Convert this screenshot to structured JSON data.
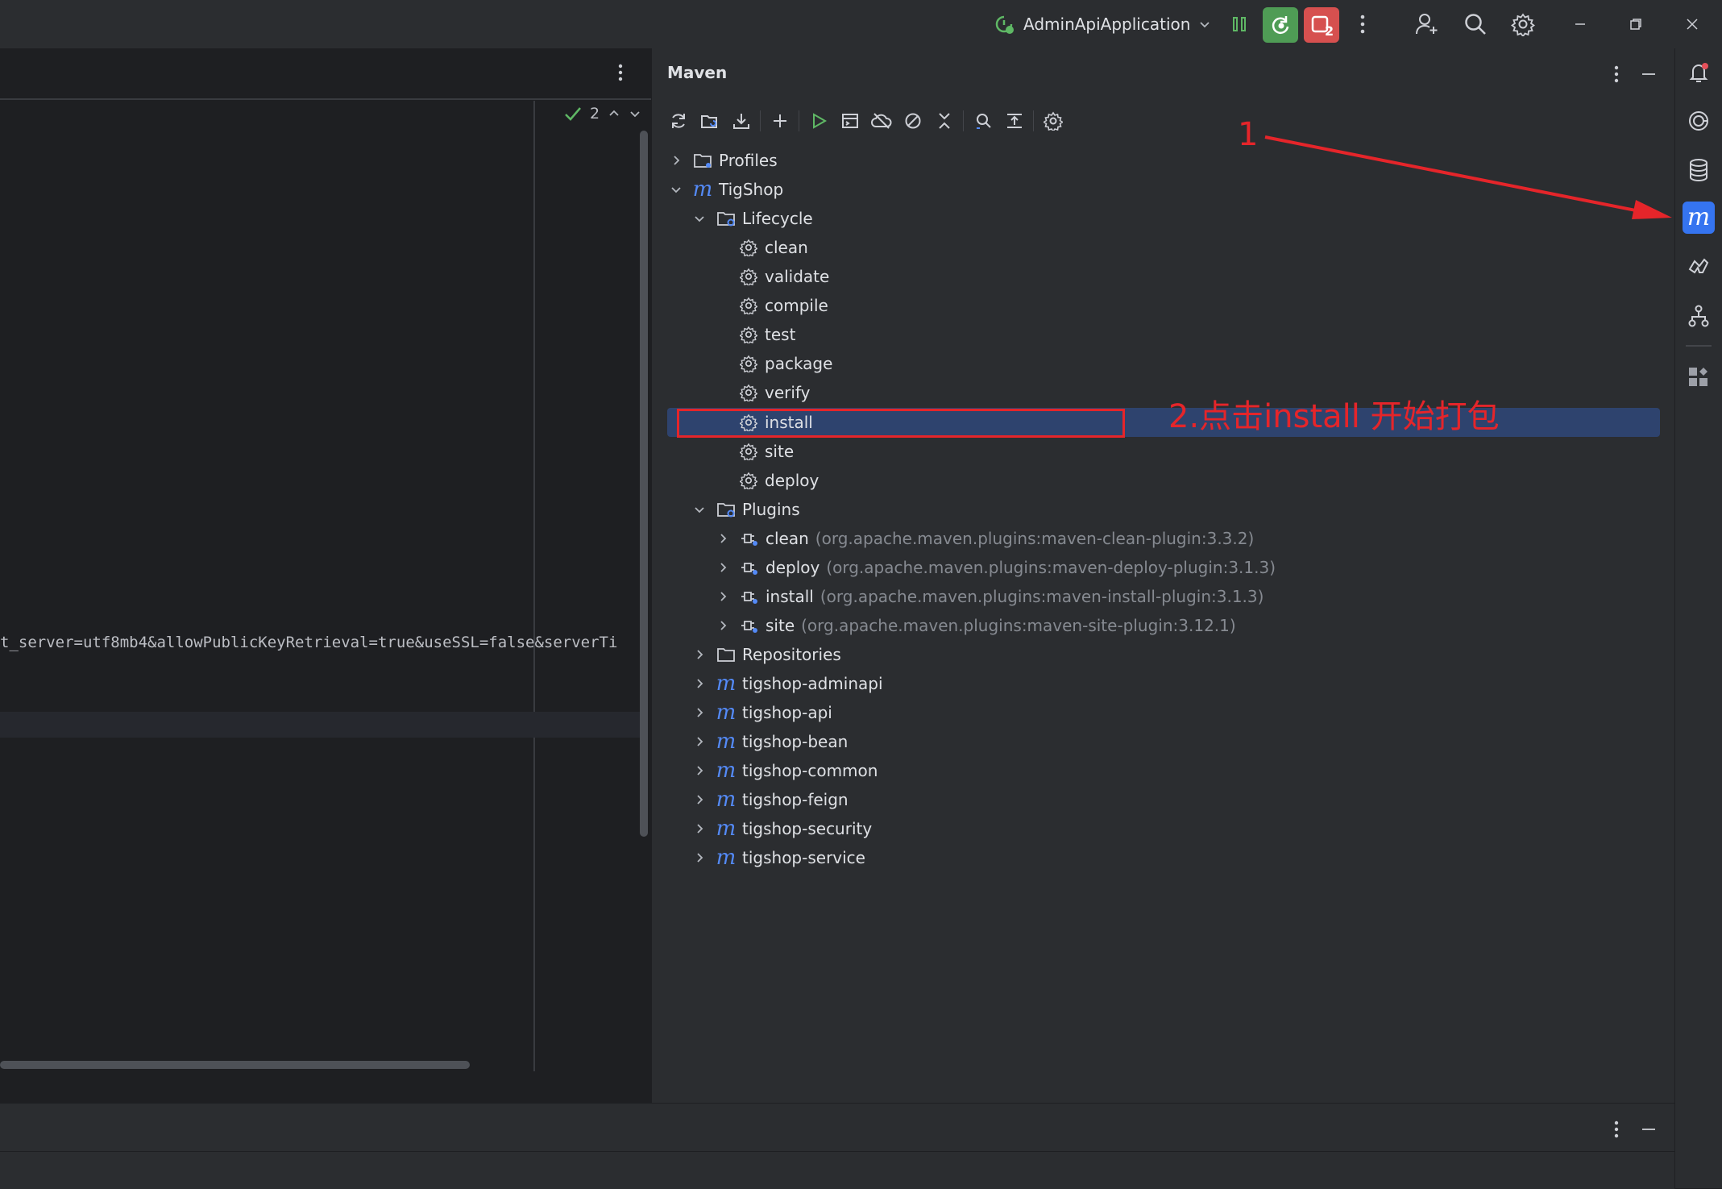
{
  "titlebar": {
    "run_config": "AdminApiApplication",
    "debug_badge": "2"
  },
  "editor": {
    "inspection_count": "2",
    "code_fragment": "t_server=utf8mb4&allowPublicKeyRetrieval=true&useSSL=false&serverTi"
  },
  "maven": {
    "title": "Maven",
    "tree": {
      "profiles": "Profiles",
      "root": "TigShop",
      "lifecycle": "Lifecycle",
      "lifecycle_items": [
        "clean",
        "validate",
        "compile",
        "test",
        "package",
        "verify",
        "install",
        "site",
        "deploy"
      ],
      "plugins": "Plugins",
      "plugin_items": [
        {
          "name": "clean",
          "coords": "(org.apache.maven.plugins:maven-clean-plugin:3.3.2)"
        },
        {
          "name": "deploy",
          "coords": "(org.apache.maven.plugins:maven-deploy-plugin:3.1.3)"
        },
        {
          "name": "install",
          "coords": "(org.apache.maven.plugins:maven-install-plugin:3.1.3)"
        },
        {
          "name": "site",
          "coords": "(org.apache.maven.plugins:maven-site-plugin:3.12.1)"
        }
      ],
      "repositories": "Repositories",
      "modules": [
        "tigshop-adminapi",
        "tigshop-api",
        "tigshop-bean",
        "tigshop-common",
        "tigshop-feign",
        "tigshop-security",
        "tigshop-service"
      ]
    },
    "selected_item": "install"
  },
  "annotations": {
    "step1": "1",
    "step2": "2.点击install 开始打包",
    "color": "#e5252a"
  },
  "colors": {
    "background": "#1e1f22",
    "panel": "#2b2d30",
    "selection": "#2e436e",
    "maven_accent": "#548af7",
    "run_green": "#4f9c55",
    "stop_red": "#d6504f"
  }
}
